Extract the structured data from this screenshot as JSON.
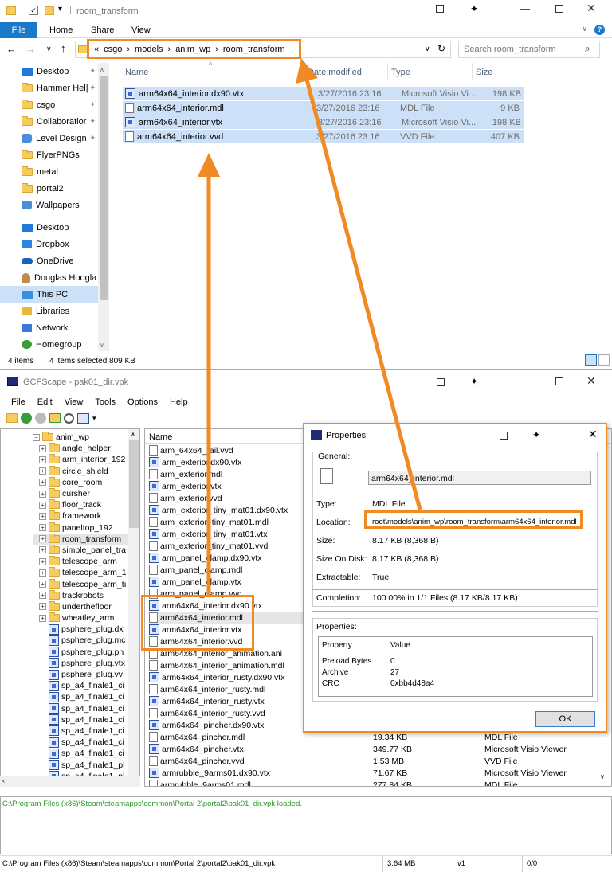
{
  "explorer": {
    "title": "room_transform",
    "ribbon_tabs": [
      "File",
      "Home",
      "Share",
      "View"
    ],
    "breadcrumb": {
      "prefix": "«",
      "parts": [
        "csgo",
        "models",
        "anim_wp",
        "room_transform"
      ],
      "sep": "›"
    },
    "search_placeholder": "Search room_transform",
    "columns": {
      "name": "Name",
      "date": "Date modified",
      "type": "Type",
      "size": "Size"
    },
    "files": [
      {
        "name": "arm64x64_interior.dx90.vtx",
        "date": "3/27/2016 23:16",
        "type": "Microsoft Visio Vi...",
        "size": "198 KB",
        "icon": "visio-icon"
      },
      {
        "name": "arm64x64_interior.mdl",
        "date": "3/27/2016 23:16",
        "type": "MDL File",
        "size": "9 KB",
        "icon": "file-icon"
      },
      {
        "name": "arm64x64_interior.vtx",
        "date": "3/27/2016 23:16",
        "type": "Microsoft Visio Vi...",
        "size": "198 KB",
        "icon": "visio-icon"
      },
      {
        "name": "arm64x64_interior.vvd",
        "date": "3/27/2016 23:16",
        "type": "VVD File",
        "size": "407 KB",
        "icon": "file-icon"
      }
    ],
    "nav": [
      {
        "label": "Desktop",
        "icon": "desktop-icon",
        "pin": true
      },
      {
        "label": "Hammer Hel|",
        "icon": "folder-icon",
        "pin": true
      },
      {
        "label": "csgo",
        "icon": "folder-icon",
        "pin": true
      },
      {
        "label": "Collaboratior",
        "icon": "folder-icon",
        "pin": true
      },
      {
        "label": "Level Design",
        "icon": "people-icon",
        "pin": true
      },
      {
        "label": "FlyerPNGs",
        "icon": "folder-icon",
        "pin": false
      },
      {
        "label": "metal",
        "icon": "folder-icon",
        "pin": false
      },
      {
        "label": "portal2",
        "icon": "folder-icon",
        "pin": false
      },
      {
        "label": "Wallpapers",
        "icon": "people-icon",
        "pin": false
      },
      {
        "label": "Desktop",
        "icon": "desktop-icon",
        "pin": false
      },
      {
        "label": "Dropbox",
        "icon": "dropbox-icon",
        "pin": false
      },
      {
        "label": "OneDrive",
        "icon": "cloud-icon",
        "pin": false
      },
      {
        "label": "Douglas Hoogla",
        "icon": "user-icon",
        "pin": false
      },
      {
        "label": "This PC",
        "icon": "computer-icon",
        "pin": false
      },
      {
        "label": "Libraries",
        "icon": "library-icon",
        "pin": false
      },
      {
        "label": "Network",
        "icon": "network-icon",
        "pin": false
      },
      {
        "label": "Homegroup",
        "icon": "homegroup-icon",
        "pin": false
      }
    ],
    "status_items": "4 items",
    "status_selected": "4 items selected  809 KB"
  },
  "gcf": {
    "title": "GCFScape - pak01_dir.vpk",
    "menu": [
      "File",
      "Edit",
      "View",
      "Tools",
      "Options",
      "Help"
    ],
    "tree_root": "anim_wp",
    "tree_folders": [
      "angle_helper",
      "arm_interior_192",
      "circle_shield",
      "core_room",
      "cursher",
      "floor_track",
      "framework",
      "paneltop_192",
      "room_transform",
      "simple_panel_tra",
      "telescope_arm",
      "telescope_arm_1",
      "telescope_arm_tı",
      "trackrobots",
      "underthefloor",
      "wheatley_arm"
    ],
    "tree_files": [
      "psphere_plug.dx",
      "psphere_plug.mc",
      "psphere_plug.ph",
      "psphere_plug.vtx",
      "psphere_plug.vv",
      "sp_a4_finale1_ci",
      "sp_a4_finale1_ci",
      "sp_a4_finale1_ci",
      "sp_a4_finale1_ci",
      "sp_a4_finale1_ci",
      "sp_a4_finale1_ci",
      "sp_a4_finale1_ci",
      "sp_a4_finale1_pl",
      "sp_a4_finale1_pl"
    ],
    "list_header": "Name",
    "list_files": [
      "arm_64x64_rail.vvd",
      "arm_exterior.dx90.vtx",
      "arm_exterior.mdl",
      "arm_exterior.vtx",
      "arm_exterior.vvd",
      "arm_exterior_tiny_mat01.dx90.vtx",
      "arm_exterior_tiny_mat01.mdl",
      "arm_exterior_tiny_mat01.vtx",
      "arm_exterior_tiny_mat01.vvd",
      "arm_panel_clamp.dx90.vtx",
      "arm_panel_clamp.mdl",
      "arm_panel_clamp.vtx",
      "arm_panel_clamp.vvd",
      "arm64x64_interior.dx90.vtx",
      "arm64x64_interior.mdl",
      "arm64x64_interior.vtx",
      "arm64x64_interior.vvd",
      "arm64x64_interior_animation.ani",
      "arm64x64_interior_animation.mdl",
      "arm64x64_interior_rusty.dx90.vtx",
      "arm64x64_interior_rusty.mdl",
      "arm64x64_interior_rusty.vtx",
      "arm64x64_interior_rusty.vvd",
      "arm64x64_pincher.dx90.vtx",
      "arm64x64_pincher.mdl",
      "arm64x64_pincher.vtx",
      "arm64x64_pincher.vvd",
      "armrubble_9arms01.dx90.vtx",
      "armrubble_9arms01.mdl"
    ],
    "right_rows": [
      {
        "size": "19.34 KB",
        "type": "MDL File"
      },
      {
        "size": "349.77 KB",
        "type": "Microsoft Visio Viewer"
      },
      {
        "size": "1.53 MB",
        "type": "VVD File"
      },
      {
        "size": "71.67 KB",
        "type": "Microsoft Visio Viewer"
      },
      {
        "size": "277.84 KB",
        "type": "MDL File"
      }
    ],
    "log": "C:\\Program Files (x86)\\Steam\\steamapps\\common\\Portal 2\\portal2\\pak01_dir.vpk loaded.",
    "status_path": "C:\\Program Files (x86)\\Steam\\steamapps\\common\\Portal 2\\portal2\\pak01_dir.vpk",
    "status_size": "3.64 MB",
    "status_ver": "v1",
    "status_count": "0/0"
  },
  "props": {
    "title": "Properties",
    "general": "General:",
    "filename": "arm64x64_interior.mdl",
    "fields": [
      {
        "label": "Type:",
        "value": "MDL File"
      },
      {
        "label": "Location:",
        "value": "root\\models\\anim_wp\\room_transform\\arm64x64_interior.mdl"
      },
      {
        "label": "Size:",
        "value": "8.17 KB (8,368 B)"
      },
      {
        "label": "Size On Disk:",
        "value": "8.17 KB (8,368 B)"
      },
      {
        "label": "Extractable:",
        "value": "True"
      }
    ],
    "completion_label": "Completion:",
    "completion_value": "100.00% in 1/1 Files (8.17 KB/8.17 KB)",
    "properties_label": "Properties:",
    "col_property": "Property",
    "col_value": "Value",
    "rows": [
      {
        "p": "Preload Bytes",
        "v": "0"
      },
      {
        "p": "Archive",
        "v": "27"
      },
      {
        "p": "CRC",
        "v": "0xbb4d48a4"
      }
    ],
    "ok": "OK"
  },
  "colors": {
    "accent": "#f08a24",
    "blue": "#1979ca",
    "selection": "#cce0f7"
  }
}
